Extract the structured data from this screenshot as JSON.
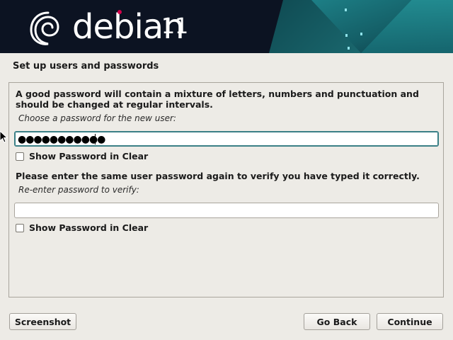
{
  "header": {
    "brand": "debian",
    "version": "11",
    "colors": {
      "background": "#0c1322",
      "accent_teal": "#1d7f86",
      "dot": "#d4004a"
    }
  },
  "page": {
    "title": "Set up users and passwords"
  },
  "form": {
    "intro": [
      "A good password will contain a mixture of letters, numbers and punctuation and",
      "should be changed at regular intervals."
    ],
    "password_label": "Choose a password for the new user:",
    "password_masked": "●●●●●●●●●●●",
    "show_password_1": "Show Password in Clear",
    "verify_prompt": "Please enter the same user password again to verify you have typed it correctly.",
    "verify_label": "Re-enter password to verify:",
    "verify_value": "",
    "show_password_2": "Show Password in Clear"
  },
  "buttons": {
    "screenshot": "Screenshot",
    "go_back": "Go Back",
    "continue": "Continue"
  }
}
